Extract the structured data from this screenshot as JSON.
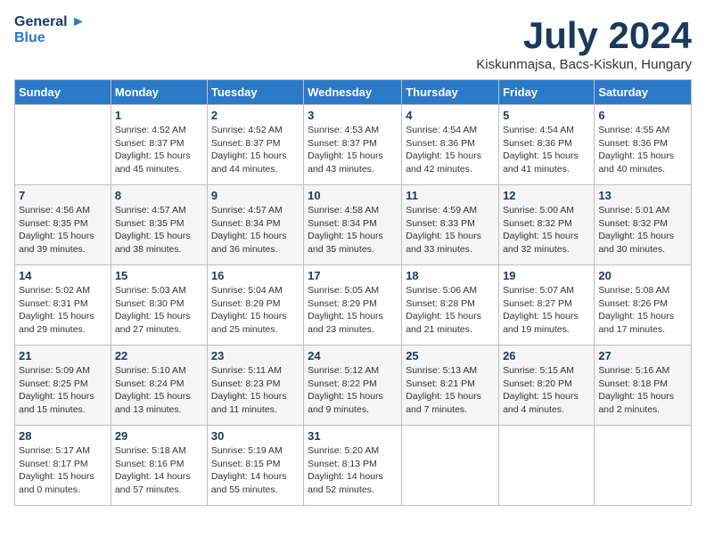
{
  "header": {
    "logo_line1": "General",
    "logo_line2": "Blue",
    "month_title": "July 2024",
    "subtitle": "Kiskunmajsa, Bacs-Kiskun, Hungary"
  },
  "days_of_week": [
    "Sunday",
    "Monday",
    "Tuesday",
    "Wednesday",
    "Thursday",
    "Friday",
    "Saturday"
  ],
  "weeks": [
    [
      {
        "day": "",
        "info": ""
      },
      {
        "day": "1",
        "info": "Sunrise: 4:52 AM\nSunset: 8:37 PM\nDaylight: 15 hours\nand 45 minutes."
      },
      {
        "day": "2",
        "info": "Sunrise: 4:52 AM\nSunset: 8:37 PM\nDaylight: 15 hours\nand 44 minutes."
      },
      {
        "day": "3",
        "info": "Sunrise: 4:53 AM\nSunset: 8:37 PM\nDaylight: 15 hours\nand 43 minutes."
      },
      {
        "day": "4",
        "info": "Sunrise: 4:54 AM\nSunset: 8:36 PM\nDaylight: 15 hours\nand 42 minutes."
      },
      {
        "day": "5",
        "info": "Sunrise: 4:54 AM\nSunset: 8:36 PM\nDaylight: 15 hours\nand 41 minutes."
      },
      {
        "day": "6",
        "info": "Sunrise: 4:55 AM\nSunset: 8:36 PM\nDaylight: 15 hours\nand 40 minutes."
      }
    ],
    [
      {
        "day": "7",
        "info": "Sunrise: 4:56 AM\nSunset: 8:35 PM\nDaylight: 15 hours\nand 39 minutes."
      },
      {
        "day": "8",
        "info": "Sunrise: 4:57 AM\nSunset: 8:35 PM\nDaylight: 15 hours\nand 38 minutes."
      },
      {
        "day": "9",
        "info": "Sunrise: 4:57 AM\nSunset: 8:34 PM\nDaylight: 15 hours\nand 36 minutes."
      },
      {
        "day": "10",
        "info": "Sunrise: 4:58 AM\nSunset: 8:34 PM\nDaylight: 15 hours\nand 35 minutes."
      },
      {
        "day": "11",
        "info": "Sunrise: 4:59 AM\nSunset: 8:33 PM\nDaylight: 15 hours\nand 33 minutes."
      },
      {
        "day": "12",
        "info": "Sunrise: 5:00 AM\nSunset: 8:32 PM\nDaylight: 15 hours\nand 32 minutes."
      },
      {
        "day": "13",
        "info": "Sunrise: 5:01 AM\nSunset: 8:32 PM\nDaylight: 15 hours\nand 30 minutes."
      }
    ],
    [
      {
        "day": "14",
        "info": "Sunrise: 5:02 AM\nSunset: 8:31 PM\nDaylight: 15 hours\nand 29 minutes."
      },
      {
        "day": "15",
        "info": "Sunrise: 5:03 AM\nSunset: 8:30 PM\nDaylight: 15 hours\nand 27 minutes."
      },
      {
        "day": "16",
        "info": "Sunrise: 5:04 AM\nSunset: 8:29 PM\nDaylight: 15 hours\nand 25 minutes."
      },
      {
        "day": "17",
        "info": "Sunrise: 5:05 AM\nSunset: 8:29 PM\nDaylight: 15 hours\nand 23 minutes."
      },
      {
        "day": "18",
        "info": "Sunrise: 5:06 AM\nSunset: 8:28 PM\nDaylight: 15 hours\nand 21 minutes."
      },
      {
        "day": "19",
        "info": "Sunrise: 5:07 AM\nSunset: 8:27 PM\nDaylight: 15 hours\nand 19 minutes."
      },
      {
        "day": "20",
        "info": "Sunrise: 5:08 AM\nSunset: 8:26 PM\nDaylight: 15 hours\nand 17 minutes."
      }
    ],
    [
      {
        "day": "21",
        "info": "Sunrise: 5:09 AM\nSunset: 8:25 PM\nDaylight: 15 hours\nand 15 minutes."
      },
      {
        "day": "22",
        "info": "Sunrise: 5:10 AM\nSunset: 8:24 PM\nDaylight: 15 hours\nand 13 minutes."
      },
      {
        "day": "23",
        "info": "Sunrise: 5:11 AM\nSunset: 8:23 PM\nDaylight: 15 hours\nand 11 minutes."
      },
      {
        "day": "24",
        "info": "Sunrise: 5:12 AM\nSunset: 8:22 PM\nDaylight: 15 hours\nand 9 minutes."
      },
      {
        "day": "25",
        "info": "Sunrise: 5:13 AM\nSunset: 8:21 PM\nDaylight: 15 hours\nand 7 minutes."
      },
      {
        "day": "26",
        "info": "Sunrise: 5:15 AM\nSunset: 8:20 PM\nDaylight: 15 hours\nand 4 minutes."
      },
      {
        "day": "27",
        "info": "Sunrise: 5:16 AM\nSunset: 8:18 PM\nDaylight: 15 hours\nand 2 minutes."
      }
    ],
    [
      {
        "day": "28",
        "info": "Sunrise: 5:17 AM\nSunset: 8:17 PM\nDaylight: 15 hours\nand 0 minutes."
      },
      {
        "day": "29",
        "info": "Sunrise: 5:18 AM\nSunset: 8:16 PM\nDaylight: 14 hours\nand 57 minutes."
      },
      {
        "day": "30",
        "info": "Sunrise: 5:19 AM\nSunset: 8:15 PM\nDaylight: 14 hours\nand 55 minutes."
      },
      {
        "day": "31",
        "info": "Sunrise: 5:20 AM\nSunset: 8:13 PM\nDaylight: 14 hours\nand 52 minutes."
      },
      {
        "day": "",
        "info": ""
      },
      {
        "day": "",
        "info": ""
      },
      {
        "day": "",
        "info": ""
      }
    ]
  ]
}
